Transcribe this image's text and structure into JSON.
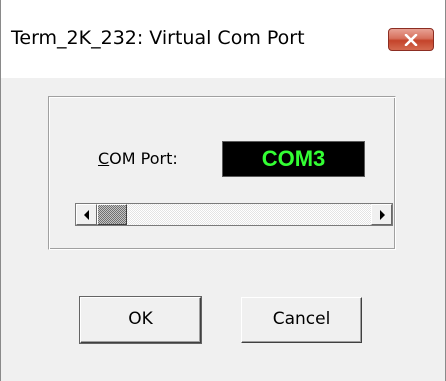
{
  "window": {
    "title": "Term_2K_232: Virtual Com Port",
    "close_icon": "close-icon"
  },
  "com_port": {
    "label_accel": "C",
    "label_rest": "OM Port:",
    "value": "COM3",
    "value_color": "#33ff33",
    "display_bg": "#000000"
  },
  "slider": {
    "left_icon": "arrow-left-icon",
    "right_icon": "arrow-right-icon",
    "position_fraction": 0.0
  },
  "buttons": {
    "ok_label": "OK",
    "cancel_label": "Cancel"
  },
  "colors": {
    "close_button": "#c4432a",
    "dialog_bg": "#f0f0f0"
  }
}
